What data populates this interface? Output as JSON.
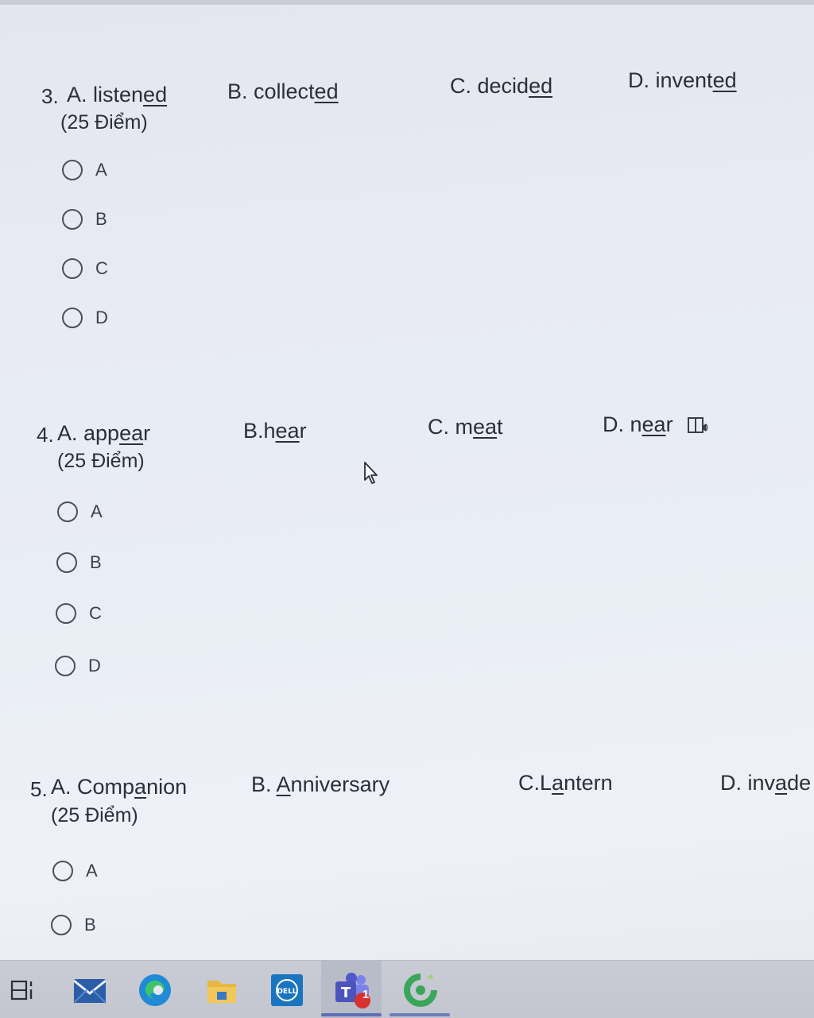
{
  "questions": [
    {
      "number": "3.",
      "options": [
        {
          "pre": "A. listen",
          "ul": "ed",
          "post": ""
        },
        {
          "pre": "B. collect",
          "ul": "ed",
          "post": ""
        },
        {
          "pre": "C. decid",
          "ul": "ed",
          "post": ""
        },
        {
          "pre": "D. invent",
          "ul": "ed",
          "post": ""
        }
      ],
      "points": "(25 Điểm)",
      "choices": [
        "A",
        "B",
        "C",
        "D"
      ]
    },
    {
      "number": "4.",
      "options": [
        {
          "pre": "A. app",
          "ul": "ea",
          "post": "r"
        },
        {
          "pre": "B.h",
          "ul": "ea",
          "post": "r"
        },
        {
          "pre": "C. m",
          "ul": "ea",
          "post": "t"
        },
        {
          "pre": "D. n",
          "ul": "ea",
          "post": "r"
        }
      ],
      "points": "(25 Điểm)",
      "choices": [
        "A",
        "B",
        "C",
        "D"
      ]
    },
    {
      "number": "5.",
      "options": [
        {
          "pre": "A. Comp",
          "ul": "a",
          "post": "nion"
        },
        {
          "pre": "B. ",
          "ul": "A",
          "post": "nniversary"
        },
        {
          "pre": "C.L",
          "ul": "a",
          "post": "ntern"
        },
        {
          "pre": "D. inv",
          "ul": "a",
          "post": "de"
        }
      ],
      "points": "(25 Điểm)",
      "choices": [
        "A",
        "B"
      ]
    }
  ],
  "icons": {
    "immersive_reader": "immersive-reader-icon",
    "cursor": "mouse-cursor-icon"
  },
  "taskbar": {
    "items": [
      "task-view-icon",
      "mail-icon",
      "edge-icon",
      "file-explorer-icon",
      "dell-icon",
      "teams-icon",
      "chrome-like-icon"
    ],
    "teams_badge": "1"
  },
  "colors": {
    "edge": "#1f8ad6",
    "mail": "#2b5ea7",
    "folder": "#e7b744",
    "teams": "#5059c9",
    "badge": "#d7322f",
    "dell": "#1a75c0"
  }
}
